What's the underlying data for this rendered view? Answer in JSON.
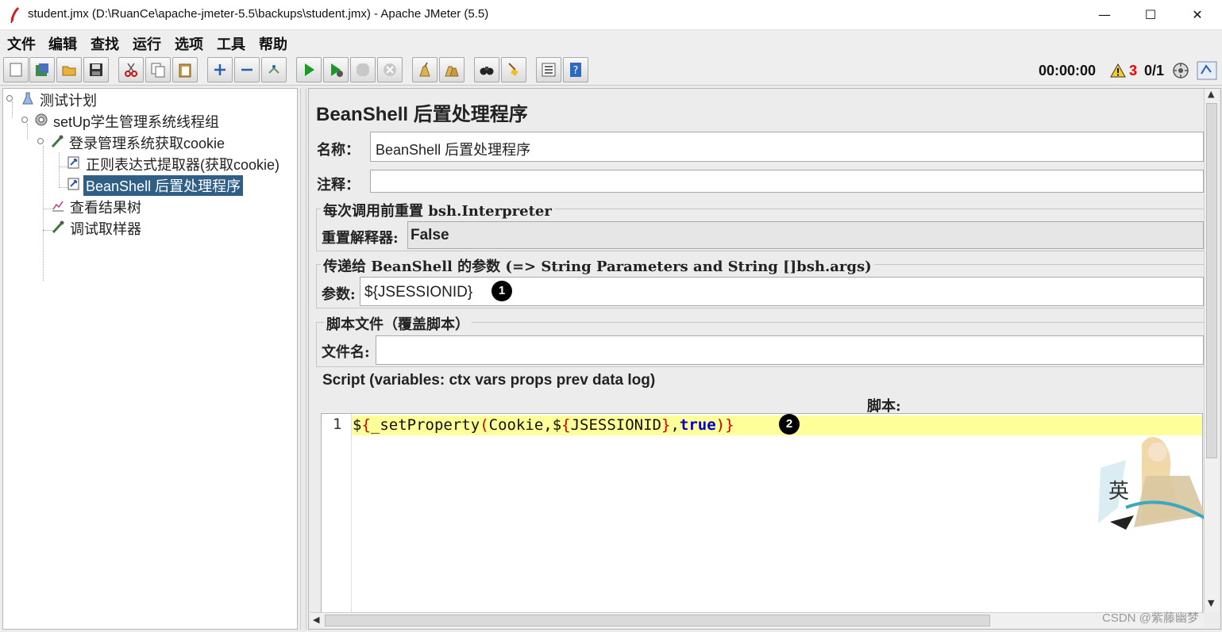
{
  "window": {
    "title": "student.jmx (D:\\RuanCe\\apache-jmeter-5.5\\backups\\student.jmx) - Apache JMeter (5.5)",
    "minimize": "—",
    "maximize": "☐",
    "close": "✕"
  },
  "menu": [
    "文件",
    "编辑",
    "查找",
    "运行",
    "选项",
    "工具",
    "帮助"
  ],
  "toolbar": {
    "icons": [
      "new-icon",
      "templates-icon",
      "open-icon",
      "save-icon",
      "cut-icon",
      "copy-icon",
      "paste-icon",
      "expand-icon",
      "collapse-icon",
      "toggle-icon",
      "start-icon",
      "start-no-pause-icon",
      "stop-icon",
      "shutdown-icon",
      "clear-icon",
      "clear-all-icon",
      "search-icon",
      "reset-search-icon",
      "function-helper-icon",
      "help-icon"
    ],
    "timer": "00:00:00",
    "error_count": "3",
    "threads": "0/1"
  },
  "tree": {
    "items": [
      {
        "label": "测试计划",
        "icon": "test-plan-icon"
      },
      {
        "label": "setUp学生管理系统线程组",
        "icon": "gear-icon"
      },
      {
        "label": "登录管理系统获取cookie",
        "icon": "sampler-icon"
      },
      {
        "label": "正则表达式提取器(获取cookie)",
        "icon": "post-processor-icon"
      },
      {
        "label": "BeanShell 后置处理程序",
        "icon": "post-processor-icon"
      },
      {
        "label": "查看结果树",
        "icon": "listener-icon"
      },
      {
        "label": "调试取样器",
        "icon": "sampler-icon"
      }
    ]
  },
  "panel": {
    "title": "BeanShell 后置处理程序",
    "name_label": "名称：",
    "name_value": "BeanShell 后置处理程序",
    "comment_label": "注释：",
    "comment_value": "",
    "reset_group": "每次调用前重置 bsh.Interpreter",
    "reset_label": "重置解释器:",
    "reset_value": "False",
    "params_group": "传递给 BeanShell 的参数 (=> String Parameters and String []bsh.args)",
    "params_label": "参数:",
    "params_value": "${JSESSIONID}",
    "file_group": "脚本文件（覆盖脚本）",
    "file_label": "文件名:",
    "file_value": "",
    "script_group": "Script (variables: ctx vars props prev data log)",
    "script_label": "脚本:",
    "line_number": "1",
    "code": {
      "t1": "$",
      "t2": "{",
      "t3": "_setProperty",
      "t4": "(",
      "t5": "Cookie,$",
      "t6": "{",
      "t7": "JSESSIONID",
      "t8": "}",
      "t9": ",",
      "t10": "true",
      "t11": ")",
      "t12": "}"
    }
  },
  "annotations": {
    "badge1": "1",
    "badge2": "2"
  },
  "watermark": "CSDN @紫藤幽梦",
  "colors": {
    "selection": "#2f5f85",
    "line_highlight": "#ffff99",
    "keyword": "#0000cc",
    "brace": "#cc0000",
    "error": "#ee0000"
  }
}
